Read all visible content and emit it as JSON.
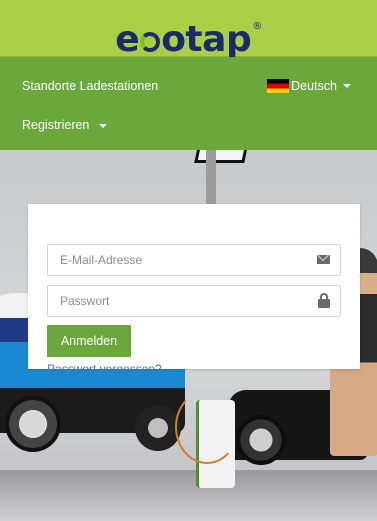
{
  "brand": {
    "logo_text_left": "e",
    "logo_text_right": "otap",
    "registered": "®"
  },
  "nav": {
    "stations_label": "Standorte Ladestationen",
    "language_label": "Deutsch",
    "register_label": "Registrieren"
  },
  "login": {
    "email_placeholder": "E-Mail-Adresse",
    "password_placeholder": "Passwort",
    "submit_label": "Anmelden",
    "forgot_label": "Passwort vergessen?"
  },
  "icons": {
    "email": "envelope-icon",
    "password": "lock-icon",
    "language": "german-flag-icon",
    "dropdown": "caret-down-icon"
  },
  "colors": {
    "header_green": "#a8cf45",
    "nav_green": "#6aa83b",
    "logo_navy": "#1b2a6b",
    "link_blue": "#3c7fb8"
  }
}
